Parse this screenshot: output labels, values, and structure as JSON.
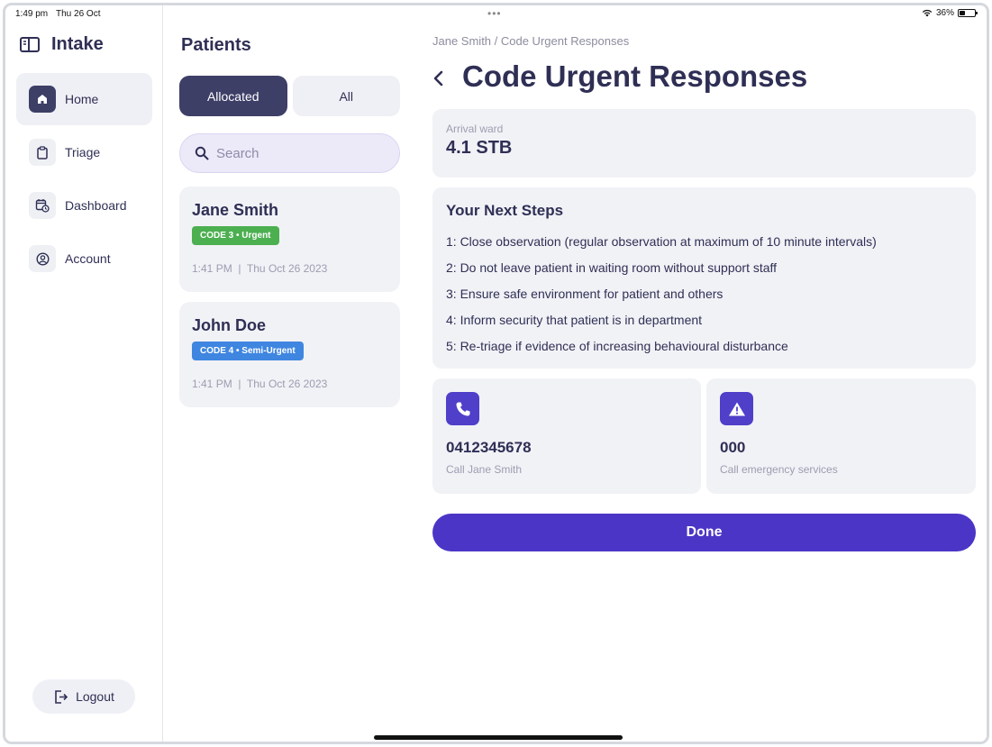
{
  "status_bar": {
    "time": "1:49 pm",
    "date": "Thu 26 Oct",
    "battery": "36%"
  },
  "brand": {
    "title": "Intake"
  },
  "nav": {
    "items": [
      {
        "label": "Home",
        "icon": "home-icon",
        "active": true
      },
      {
        "label": "Triage",
        "icon": "clipboard-icon",
        "active": false
      },
      {
        "label": "Dashboard",
        "icon": "calendar-clock-icon",
        "active": false
      },
      {
        "label": "Account",
        "icon": "user-circle-icon",
        "active": false
      }
    ],
    "logout_label": "Logout"
  },
  "patients": {
    "title": "Patients",
    "tabs": {
      "allocated": "Allocated",
      "all": "All"
    },
    "search_placeholder": "Search",
    "list": [
      {
        "name": "Jane Smith",
        "badge": "CODE 3 • Urgent",
        "badge_color": "#4caf50",
        "meta": "1:41 PM  |  Thu Oct 26 2023"
      },
      {
        "name": "John Doe",
        "badge": "CODE 4 • Semi-Urgent",
        "badge_color": "#3f86e0",
        "meta": "1:41 PM  |  Thu Oct 26 2023"
      }
    ]
  },
  "main": {
    "breadcrumb": "Jane Smith / Code Urgent Responses",
    "title": "Code Urgent Responses",
    "ward": {
      "label": "Arrival ward",
      "value": "4.1 STB"
    },
    "steps": {
      "title": "Your Next Steps",
      "items": [
        "1: Close observation (regular observation at maximum of 10 minute intervals)",
        "2: Do not leave patient in waiting room without support staff",
        "3: Ensure safe environment for patient and others",
        "4: Inform security that patient is in department",
        "5: Re-triage if evidence of increasing behavioural disturbance"
      ]
    },
    "contacts": [
      {
        "number": "0412345678",
        "label": "Call Jane Smith",
        "icon": "phone-icon"
      },
      {
        "number": "000",
        "label": "Call emergency services",
        "icon": "warning-icon"
      }
    ],
    "done_label": "Done"
  },
  "colors": {
    "primary": "#4b35c6",
    "nav_active": "#3d3f67",
    "urgent": "#4caf50",
    "semi_urgent": "#3f86e0"
  }
}
